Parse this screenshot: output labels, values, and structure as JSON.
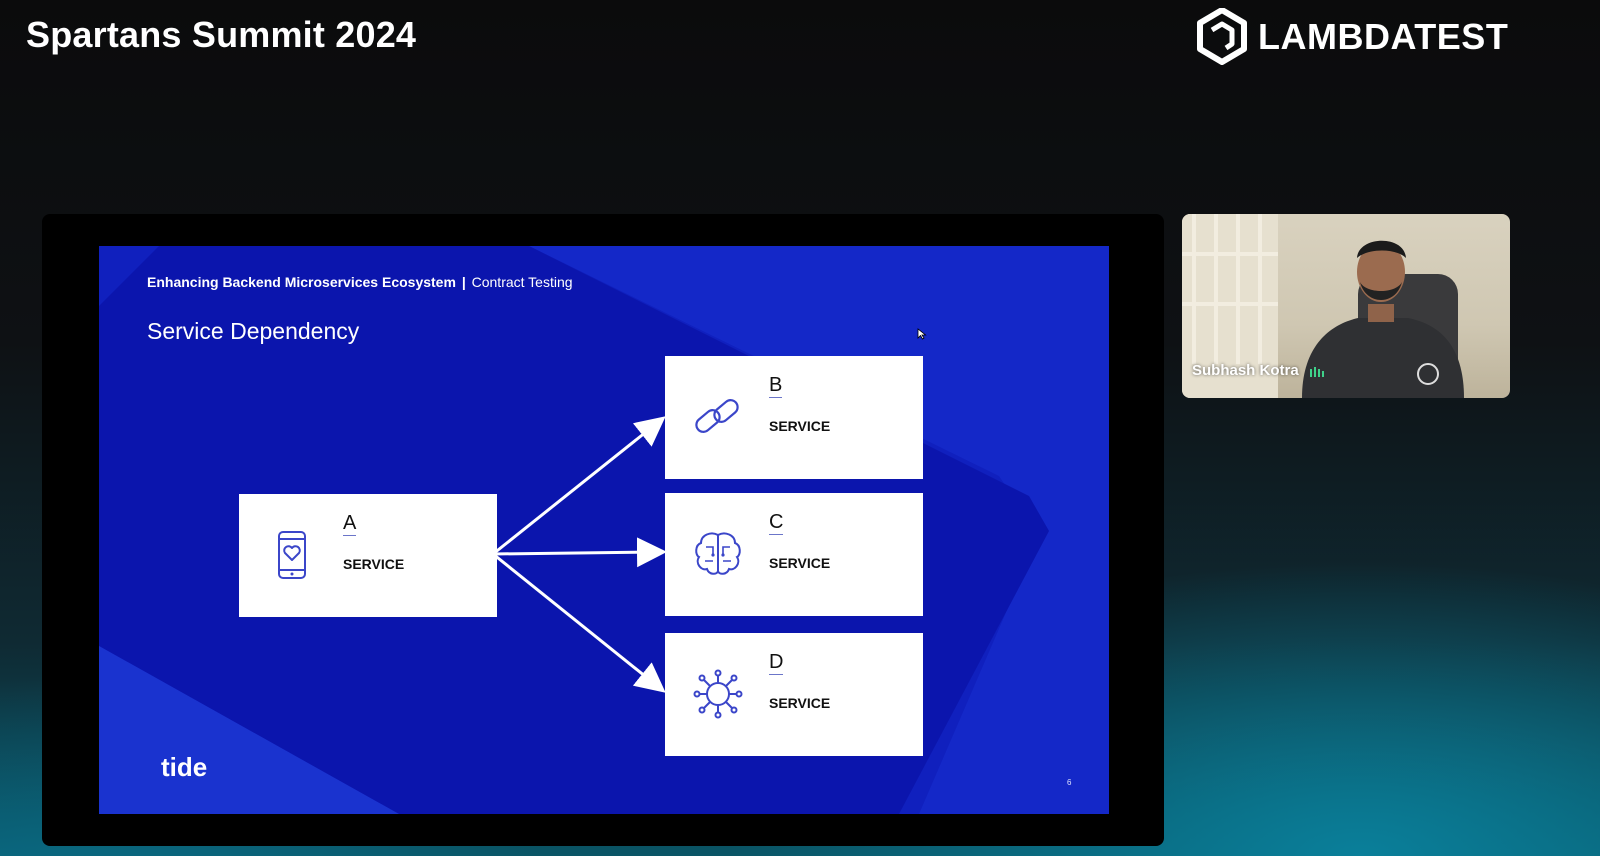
{
  "event": {
    "title": "Spartans Summit 2024"
  },
  "brand": {
    "name": "LAMBDATEST"
  },
  "slide": {
    "header_bold": "Enhancing Backend Microservices Ecosystem",
    "header_separator": "|",
    "header_light": "Contract Testing",
    "title": "Service Dependency",
    "logo_text": "tide",
    "page_number": "6",
    "services": [
      {
        "letter": "A",
        "label": "SERVICE",
        "icon": "phone-heart-icon"
      },
      {
        "letter": "B",
        "label": "SERVICE",
        "icon": "chain-link-icon"
      },
      {
        "letter": "C",
        "label": "SERVICE",
        "icon": "brain-circuit-icon"
      },
      {
        "letter": "D",
        "label": "SERVICE",
        "icon": "virus-network-icon"
      }
    ],
    "colors": {
      "background": "#1428c8",
      "accent": "#3b46c9",
      "box": "#ffffff"
    }
  },
  "participant": {
    "name": "Subhash Kotra"
  }
}
